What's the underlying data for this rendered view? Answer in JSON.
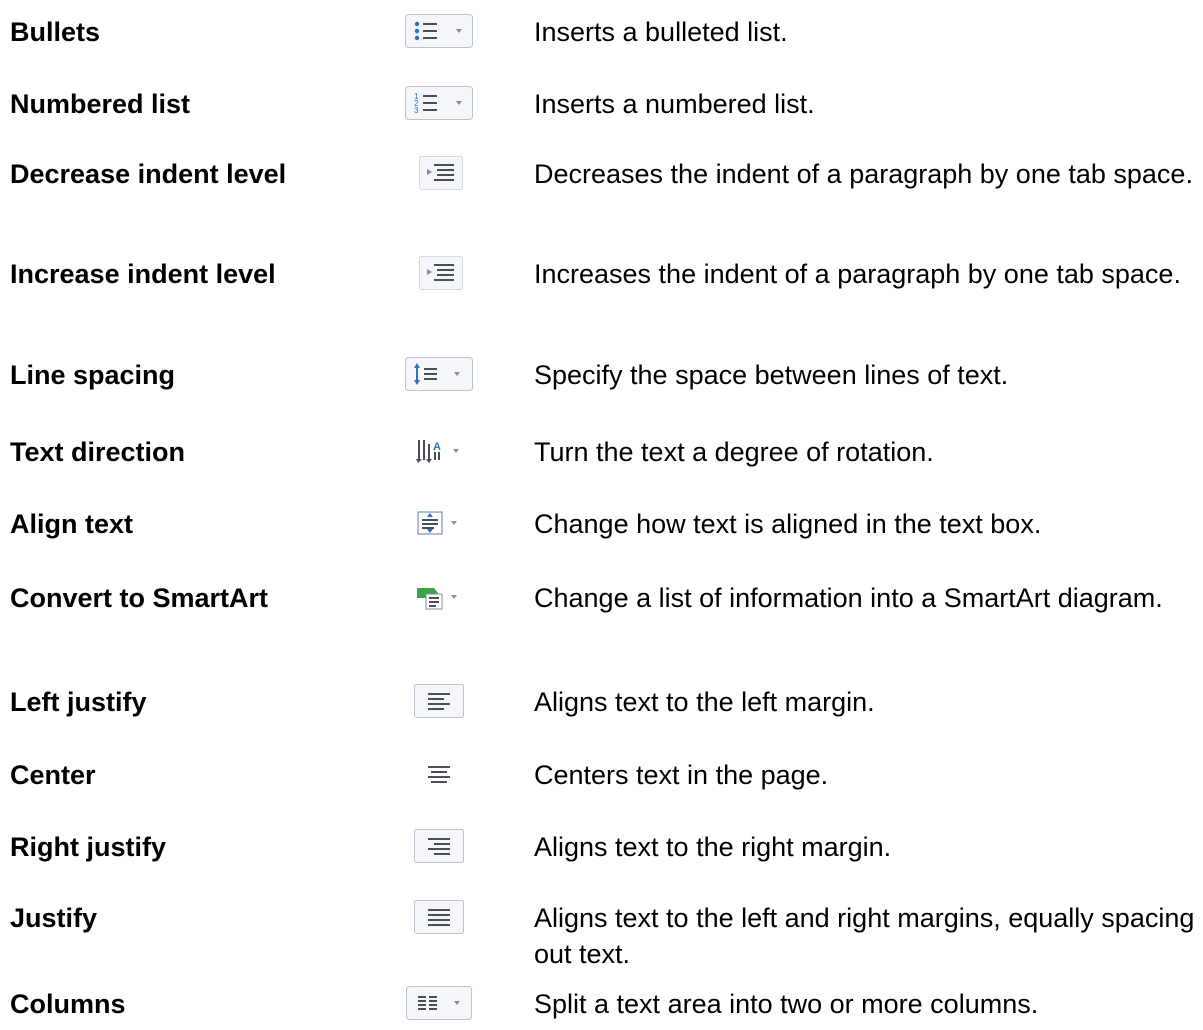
{
  "rows": [
    {
      "name": "Bullets",
      "icon": "bullets-icon",
      "desc": "Inserts a bulleted list."
    },
    {
      "name": "Numbered list",
      "icon": "numbered-list-icon",
      "desc": "Inserts a numbered list."
    },
    {
      "name": "Decrease indent level",
      "icon": "decrease-indent-icon",
      "desc": "Decreases the indent of a paragraph by one tab space."
    },
    {
      "name": "Increase indent level",
      "icon": "increase-indent-icon",
      "desc": "Increases the indent of a paragraph by one tab space."
    },
    {
      "name": "Line spacing",
      "icon": "line-spacing-icon",
      "desc": "Specify the space between lines of text."
    },
    {
      "name": "Text direction",
      "icon": "text-direction-icon",
      "desc": "Turn the text a degree of rotation."
    },
    {
      "name": "Align text",
      "icon": "align-text-icon",
      "desc": "Change how text is aligned in the text box."
    },
    {
      "name": "Convert to SmartArt",
      "icon": "convert-to-smartart-icon",
      "desc": "Change a list of information into a SmartArt diagram."
    },
    {
      "name": "Left justify",
      "icon": "align-left-icon",
      "desc": "Aligns text to the left margin."
    },
    {
      "name": "Center",
      "icon": "align-center-icon",
      "desc": "Centers text in the page."
    },
    {
      "name": "Right justify",
      "icon": "align-right-icon",
      "desc": "Aligns text to the right margin."
    },
    {
      "name": "Justify",
      "icon": "justify-icon",
      "desc": "Aligns text to the left and right margins, equally spacing out text."
    },
    {
      "name": "Columns",
      "icon": "columns-icon",
      "desc": "Split a text area into two or more columns."
    }
  ],
  "colors": {
    "icon_border": "#b9c3d1",
    "icon_bg": "#f4f6f9",
    "icon_glyph": "#4a4f57",
    "bullet_blue": "#2f6fc4",
    "smartart_green": "#3aa24a",
    "arrow_gray": "#8a8f96"
  }
}
